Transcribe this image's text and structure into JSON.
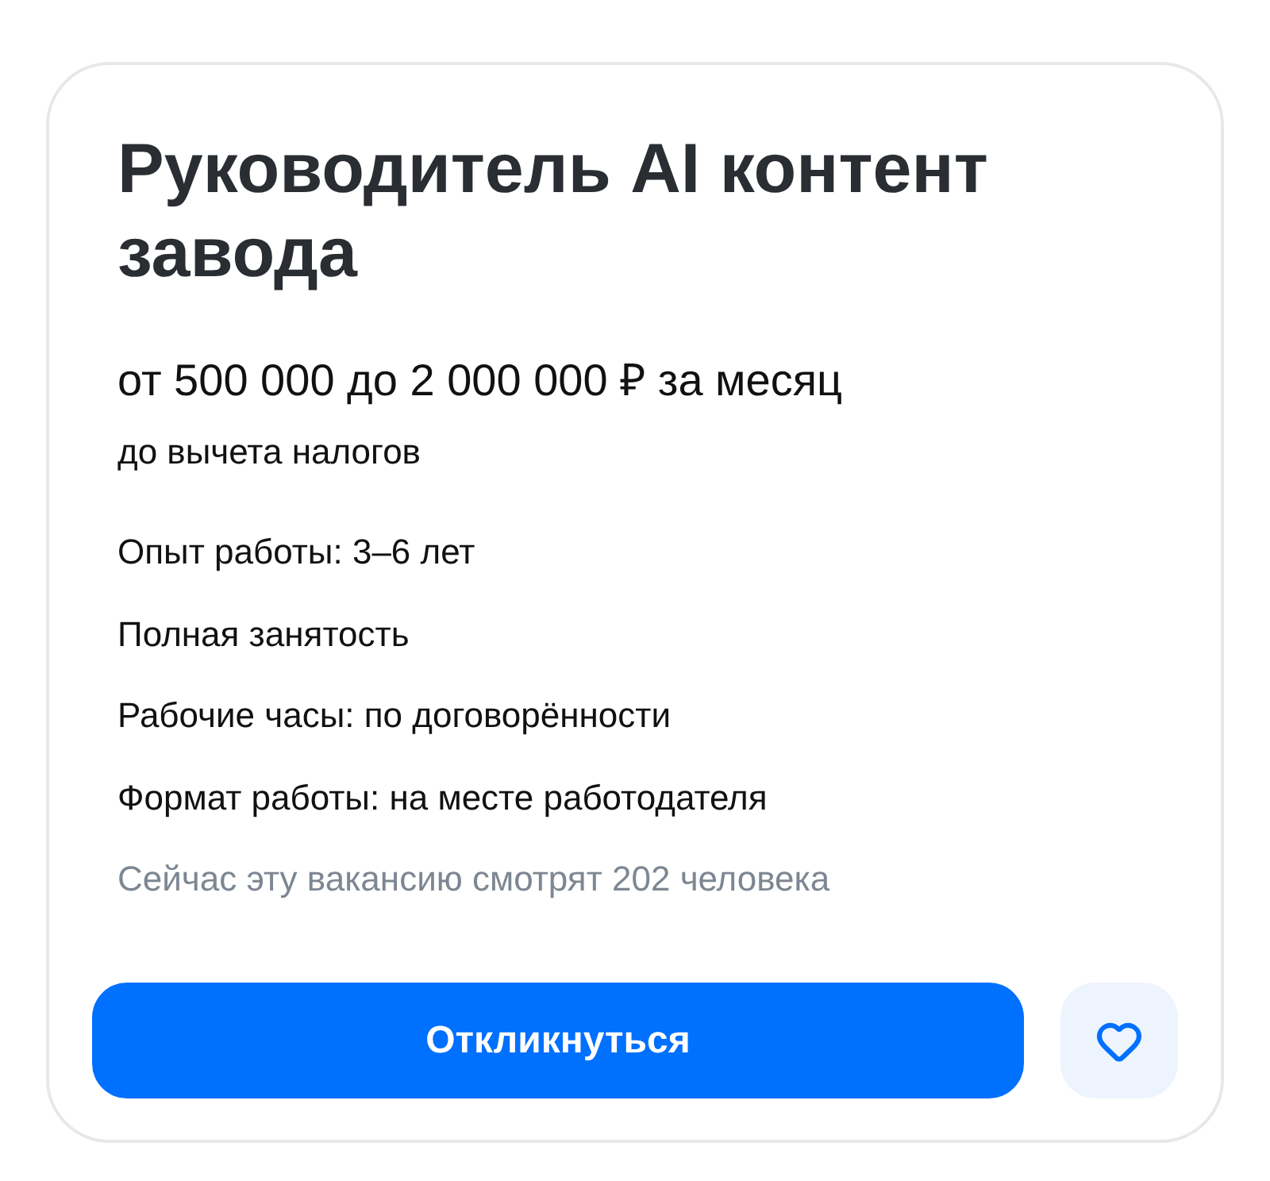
{
  "vacancy": {
    "title": "Руководитель AI контент завода",
    "salary": "от 500 000 до 2 000 000 ₽ за месяц",
    "salary_note": "до вычета налогов",
    "details": [
      "Опыт работы: 3–6 лет",
      "Полная занятость",
      "Рабочие часы: по договорённости",
      "Формат работы: на месте работодателя"
    ],
    "viewers": "Сейчас эту вакансию смотрят 202 человека"
  },
  "actions": {
    "apply_button": "Откликнуться"
  }
}
